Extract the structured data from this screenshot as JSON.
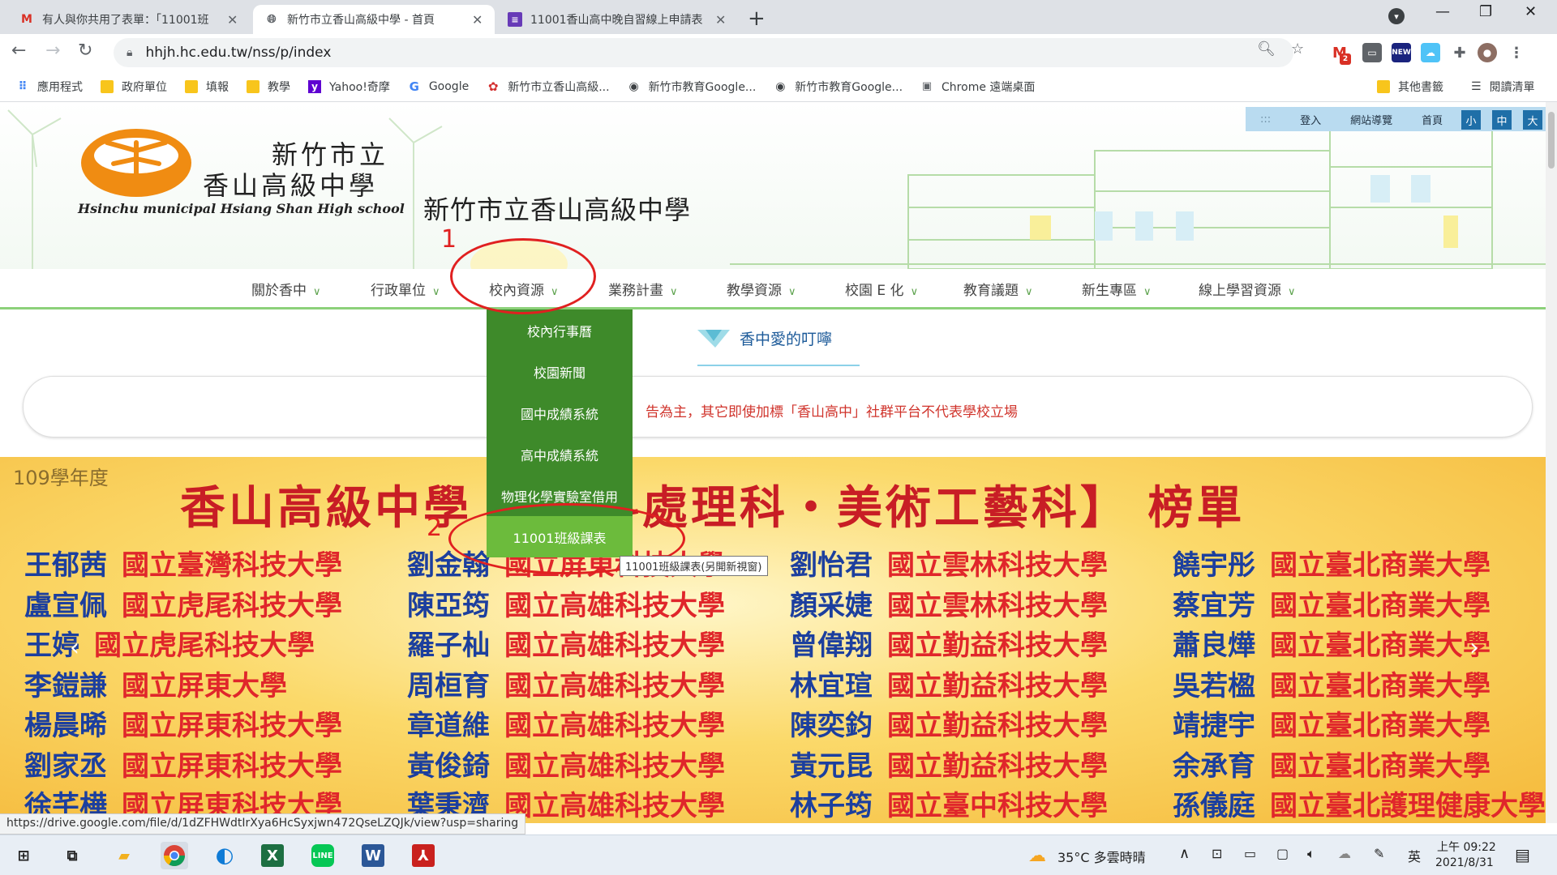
{
  "browser": {
    "tabs": [
      {
        "title": "有人與你共用了表單：「11001班",
        "icon": "M"
      },
      {
        "title": "新竹市立香山高級中學 - 首頁",
        "icon": "globe"
      },
      {
        "title": "11001香山高中晚自習線上申請表",
        "icon": "form"
      }
    ],
    "url": "hhjh.hc.edu.tw/nss/p/index",
    "gmail_badge": "2",
    "bookmarks": [
      "應用程式",
      "政府單位",
      "填報",
      "教學",
      "Yahoo!奇摩",
      "Google",
      "新竹市立香山高級...",
      "新竹市教育Google...",
      "新竹市教育Google...",
      "Chrome 遠端桌面"
    ],
    "bookmarks_right": {
      "other": "其他書籤",
      "reading": "閱讀清單"
    },
    "status_url": "https://drive.google.com/file/d/1dZFHWdtIrXya6HcSyxjwn472QseLZQJk/view?usp=sharing"
  },
  "site": {
    "logo_line1": "新竹市立",
    "logo_line2": "香山高級中學",
    "logo_en": "Hsinchu municipal Hsiang Shan High school",
    "title": "新竹市立香山高級中學",
    "topbar": {
      "dots": ":::",
      "login": "登入",
      "sitemap": "網站導覽",
      "home": "首頁",
      "small": "小",
      "medium": "中",
      "large": "大"
    },
    "nav": [
      "關於香中",
      "行政單位",
      "校內資源",
      "業務計畫",
      "教學資源",
      "校園 E 化",
      "教育議題",
      "新生專區",
      "線上學習資源"
    ],
    "dropdown": [
      "校內行事曆",
      "校園新聞",
      "國中成績系統",
      "高中成績系統",
      "物理化學實驗室借用",
      "11001班級課表"
    ],
    "tooltip": "11001班級課表(另開新視窗)",
    "notice_title": "香中愛的叮嚀",
    "marquee_text": "告為主，其它即使加標「香山高中」社群平台不代表學校立場",
    "honor": {
      "year": "109學年度",
      "title": "香山高級中學",
      "title_right": "料處理科・美術工藝科】 榜單",
      "rows": [
        [
          [
            "王郁茜",
            "國立臺灣科技大學"
          ],
          [
            "劉金翰",
            "國立屏東科技大學"
          ],
          [
            "劉怡君",
            "國立雲林科技大學"
          ],
          [
            "饒宇彤",
            "國立臺北商業大學"
          ]
        ],
        [
          [
            "盧宣佩",
            "國立虎尾科技大學"
          ],
          [
            "陳亞筠",
            "國立高雄科技大學"
          ],
          [
            "顏采婕",
            "國立雲林科技大學"
          ],
          [
            "蔡宜芳",
            "國立臺北商業大學"
          ]
        ],
        [
          [
            "王婷",
            "國立虎尾科技大學"
          ],
          [
            "羅子杣",
            "國立高雄科技大學"
          ],
          [
            "曾偉翔",
            "國立勤益科技大學"
          ],
          [
            "蕭良燁",
            "國立臺北商業大學"
          ]
        ],
        [
          [
            "李鎧謙",
            "國立屏東大學"
          ],
          [
            "周桓育",
            "國立高雄科技大學"
          ],
          [
            "林宜瑄",
            "國立勤益科技大學"
          ],
          [
            "吳若楹",
            "國立臺北商業大學"
          ]
        ],
        [
          [
            "楊晨晞",
            "國立屏東科技大學"
          ],
          [
            "章道維",
            "國立高雄科技大學"
          ],
          [
            "陳奕鈞",
            "國立勤益科技大學"
          ],
          [
            "靖捷宇",
            "國立臺北商業大學"
          ]
        ],
        [
          [
            "劉家丞",
            "國立屏東科技大學"
          ],
          [
            "黃俊錡",
            "國立高雄科技大學"
          ],
          [
            "黃元昆",
            "國立勤益科技大學"
          ],
          [
            "余承育",
            "國立臺北商業大學"
          ]
        ],
        [
          [
            "徐芊樺",
            "國立屏東科技大學"
          ],
          [
            "葉秉濟",
            "國立高雄科技大學"
          ],
          [
            "林子筠",
            "國立臺中科技大學"
          ],
          [
            "孫儀庭",
            "國立臺北護理健康大學"
          ]
        ]
      ]
    },
    "annotations": {
      "step1": "1",
      "step2": "2"
    }
  },
  "taskbar": {
    "weather": "35°C 多雲時晴",
    "ime": "英",
    "time": "上午 09:22",
    "date": "2021/8/31"
  },
  "colors": {
    "nav_green": "#3e8a2a",
    "highlight_green": "#6cbb3c",
    "annotation_red": "#e02020",
    "honor_red": "#e0262b",
    "honor_blue": "#1c3f9e"
  }
}
